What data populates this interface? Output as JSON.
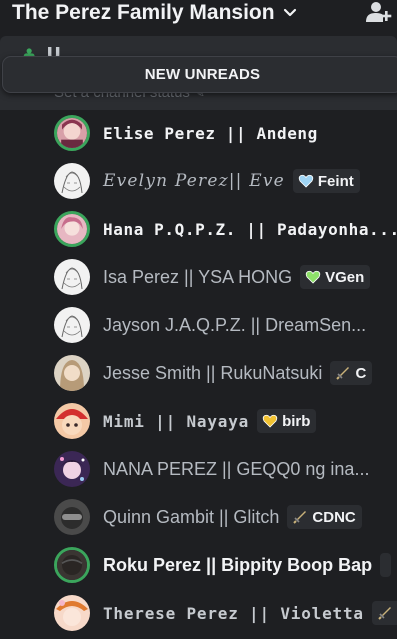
{
  "header": {
    "server_name": "The Perez Family Mansion"
  },
  "channel": {
    "name": "U",
    "status_placeholder": "Set a channel status"
  },
  "banner": {
    "label": "NEW UNREADS"
  },
  "members": [
    {
      "name": "Elise Perez || Andeng",
      "style": "deco",
      "ring": true,
      "avatar": "pink-girl",
      "tag": null
    },
    {
      "name": "Evelyn Perez|| Eve",
      "style": "deco-dim",
      "ring": false,
      "avatar": "sketch-white",
      "tag": {
        "label": "Feint",
        "icon": "heart-blue-icon",
        "color": "#9fd4f4"
      }
    },
    {
      "name": "Hana P.Q.P.Z. || Padayonha...",
      "style": "deco",
      "ring": true,
      "avatar": "pink-anime",
      "tag": null
    },
    {
      "name": "Isa Perez || YSA HONG",
      "style": "plain",
      "ring": false,
      "avatar": "sketch-white",
      "tag": {
        "label": "VGen",
        "icon": "heart-green-icon",
        "color": "#8ee06a"
      }
    },
    {
      "name": "Jayson J.A.Q.P.Z. || DreamSen...",
      "style": "plain",
      "ring": false,
      "avatar": "sketch-white",
      "tag": null
    },
    {
      "name": "Jesse Smith || RukuNatsuki",
      "style": "plain",
      "ring": false,
      "avatar": "tan-hair",
      "tag": {
        "label": "C",
        "icon": "sword-icon",
        "color": "#c9b27a"
      }
    },
    {
      "name": "Mimi || Nayaya",
      "style": "deco-mid",
      "ring": false,
      "avatar": "red-cap",
      "tag": {
        "label": "birb",
        "icon": "heart-yellow-icon",
        "color": "#f1c232"
      }
    },
    {
      "name": "NANA PEREZ || GEQQ0 ng ina...",
      "style": "plain",
      "ring": false,
      "avatar": "purple-stars",
      "tag": null
    },
    {
      "name": "Quinn Gambit || Glitch",
      "style": "plain",
      "ring": false,
      "avatar": "dark-visor",
      "tag": {
        "label": "CDNC",
        "icon": "sword-icon",
        "color": "#c9b27a"
      }
    },
    {
      "name": "Roku Perez || Bippity Boop Bap",
      "style": "bright",
      "ring": true,
      "avatar": "dark-green",
      "tag": {
        "label": "",
        "icon": "blank",
        "color": "#2b2d31"
      }
    },
    {
      "name": "Therese Perez || Violetta",
      "style": "deco-mid",
      "ring": false,
      "avatar": "orange-hat",
      "tag": {
        "label": "",
        "icon": "sword-icon",
        "color": "#c9b27a"
      }
    }
  ]
}
